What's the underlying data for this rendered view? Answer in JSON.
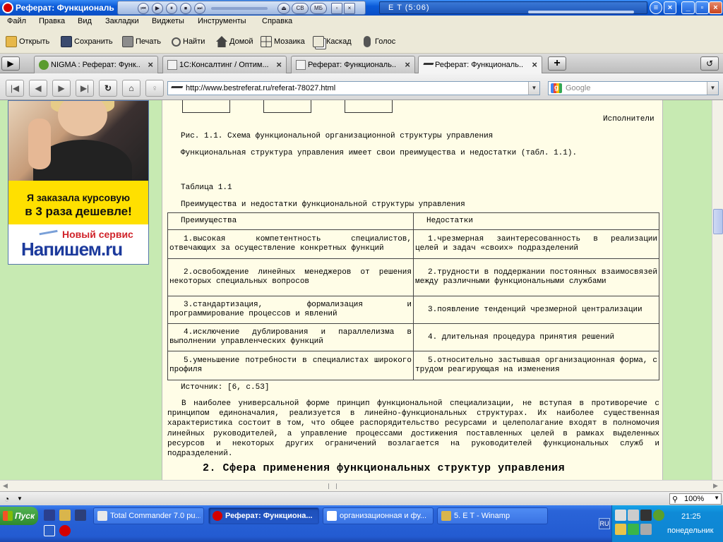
{
  "window": {
    "title": "Реферат: Функциональ",
    "winamp_info": "E T  (5:06)",
    "winamp_buttons": [
      "⏮",
      "▶",
      "⏸",
      "⏹",
      "⏭"
    ],
    "winamp_extras": [
      "CB",
      "МБ"
    ]
  },
  "menu": [
    "Файл",
    "Правка",
    "Вид",
    "Закладки",
    "Виджеты",
    "Инструменты",
    "Справка"
  ],
  "toolbar": {
    "open": "Открыть",
    "save": "Сохранить",
    "print": "Печать",
    "find": "Найти",
    "home": "Домой",
    "mosaic": "Мозаика",
    "cascade": "Каскад",
    "voice": "Голос"
  },
  "tabs": [
    {
      "label": "NIGMA : Реферат: Функ..."
    },
    {
      "label": "1С:Консалтинг / Оптим..."
    },
    {
      "label": "Реферат: Функциональ..."
    },
    {
      "label": "Реферат: Функциональ..."
    }
  ],
  "address": {
    "url": "http://www.bestreferat.ru/referat-78027.html",
    "search_placeholder": "Google"
  },
  "ad": {
    "line1": "Я заказала курсовую",
    "line2": "в 3 раза дешевле!",
    "new_service": "Новый сервис",
    "brand": "Напишем.ru"
  },
  "doc": {
    "executors": "Исполнители",
    "figure_caption": "Рис. 1.1. Схема функциональной организационной структуры управления",
    "intro": "Функциональная структура управления имеет свои преимущества и недостатки (табл. 1.1).",
    "table_label": "Таблица 1.1",
    "table_title": "Преимущества и недостатки функциональной структуры управления",
    "table_headers": [
      "Преимущества",
      "Недостатки"
    ],
    "table_rows": [
      [
        "1.высокая компетентность специалистов, отвечающих за осуществление конкретных функций",
        "1.чрезмерная заинтересованность в реализации целей и задач «своих» подразделений"
      ],
      [
        "2.освобождение линейных менеджеров от решения некоторых специальных вопросов",
        "2.трудности в поддержании постоянных взаимосвязей между различными функциональными службами"
      ],
      [
        "3.стандартизация, формализация и программирование процессов и явлений",
        "3.появление тенденций чрезмерной централизации"
      ],
      [
        "4.исключение дублирования и параллелизма в выполнении управленческих функций",
        "4. длительная процедура принятия решений"
      ],
      [
        "5.уменьшение потребности в специалистах широкого профиля",
        "5.относительно застывшая организационная форма, с трудом реагирующая на изменения"
      ]
    ],
    "source": "Источник: [6, с.53]",
    "paragraph": "В наиболее универсальной форме принцип функциональной специализации, не вступая в противоречие с принципом единоначалия, реализуется в линейно-функциональных структурах. Их наиболее существенная характеристика состоит в том, что общее распорядительство ресурсами и целеполагание входят в полномочия линейных руководителей, а управление процессами достижения поставленных целей в рамках выделенных ресурсов и некоторых других ограничений возлагается на руководителей функциональных служб и подразделений.",
    "heading": "2. Сфера применения функциональных структур управления"
  },
  "status": {
    "zoom": "100%"
  },
  "taskbar": {
    "start": "Пуск",
    "tasks": [
      {
        "label": "Total Commander 7.0 pu..."
      },
      {
        "label": "Реферат: Функциона..."
      },
      {
        "label": "организационная и фу..."
      },
      {
        "label": "5. E T  - Winamp"
      }
    ],
    "lang": "RU",
    "time": "21:25",
    "day": "понедельник"
  },
  "colors": {
    "page_bg": "#c7eab2",
    "doc_bg": "#fffde7",
    "taskbar": "#235bd1"
  }
}
